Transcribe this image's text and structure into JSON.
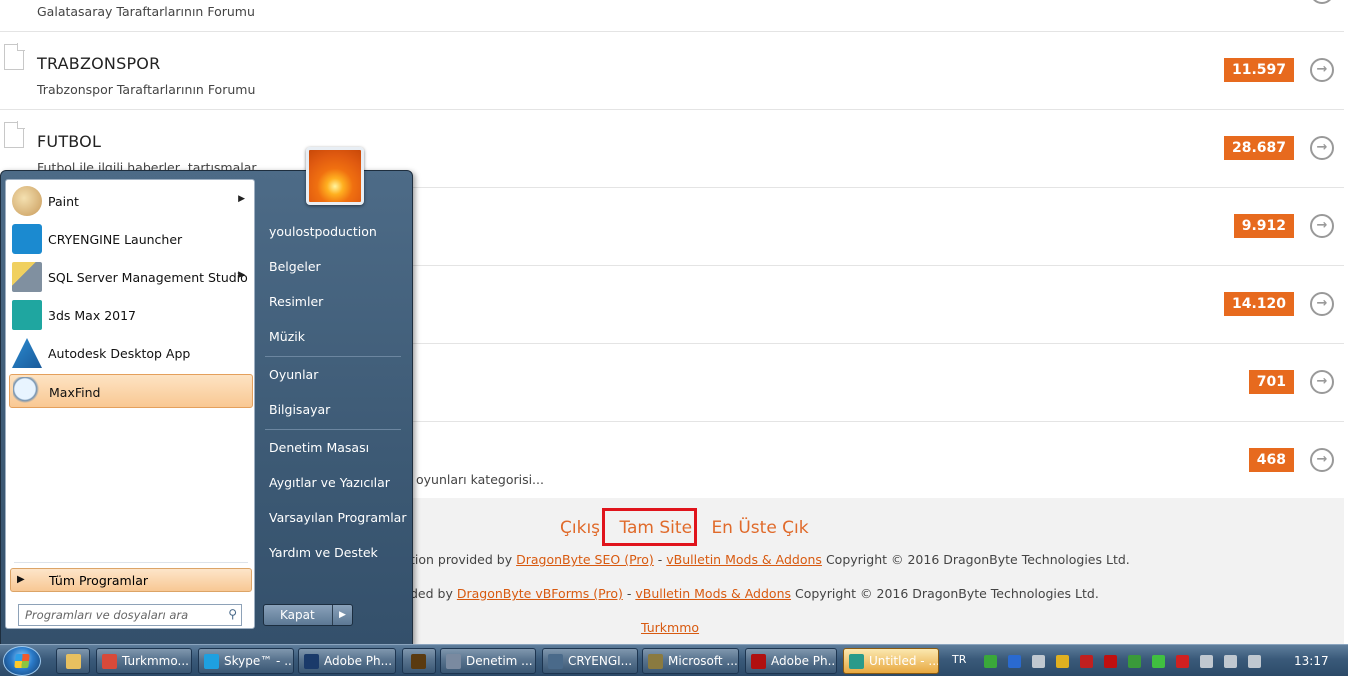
{
  "forum": {
    "rows": [
      {
        "title": "",
        "desc": "Galatasaray Taraftarlarının Forumu",
        "count": ""
      },
      {
        "title": "TRABZONSPOR",
        "desc": "Trabzonspor Taraftarlarının Forumu",
        "count": "11.597"
      },
      {
        "title": "FUTBOL",
        "desc": "Futbol ile ilgili haberler, tartışmalar",
        "count": "28.687"
      },
      {
        "title": "",
        "desc": "",
        "count": "9.912"
      },
      {
        "title": "",
        "desc": "",
        "count": "14.120"
      },
      {
        "title": "",
        "desc": "",
        "count": "701"
      },
      {
        "title": "",
        "desc": "oyunları kategorisi...",
        "count": "468"
      }
    ]
  },
  "footer": {
    "links": [
      "Çıkış",
      "Tam Site",
      "En Üste Çık"
    ],
    "line1_prefix": "tion provided by",
    "line1_link1": "DragonByte SEO (Pro)",
    "line1_sep": "-",
    "line1_link2": "vBulletin Mods & Addons",
    "line1_suffix": "Copyright © 2016 DragonByte Technologies Ltd.",
    "line2_prefix": "ded by",
    "line2_link1": "DragonByte vBForms (Pro)",
    "line2_sep": "-",
    "line2_link2": "vBulletin Mods & Addons",
    "line2_suffix": "Copyright © 2016 DragonByte Technologies Ltd.",
    "site_link": "Turkmmo"
  },
  "startmenu": {
    "programs": [
      {
        "label": "Paint",
        "icon": "paint-icon",
        "submenu": true
      },
      {
        "label": "CRYENGINE Launcher",
        "icon": "cryengine-icon",
        "submenu": false
      },
      {
        "label": "SQL Server Management Studio",
        "icon": "sql-server-icon",
        "submenu": true
      },
      {
        "label": "3ds Max 2017",
        "icon": "3dsmax-icon",
        "submenu": false
      },
      {
        "label": "Autodesk Desktop App",
        "icon": "autodesk-icon",
        "submenu": false
      },
      {
        "label": "MaxFind",
        "icon": "magnifier-icon",
        "submenu": false,
        "selected": true
      }
    ],
    "all_programs": "Tüm Programlar",
    "search_placeholder": "Programları ve dosyaları ara",
    "right_links": [
      "youlostpoduction",
      "Belgeler",
      "Resimler",
      "Müzik",
      "Oyunlar",
      "Bilgisayar",
      "Denetim Masası",
      "Aygıtlar ve Yazıcılar",
      "Varsayılan Programlar",
      "Yardım ve Destek"
    ],
    "shutdown": "Kapat"
  },
  "taskbar": {
    "buttons": [
      {
        "label": "Turkmmo...",
        "icon": "chrome-icon",
        "color": "#d84a3a"
      },
      {
        "label": "Skype™ - ...",
        "icon": "skype-icon",
        "color": "#1ea0e0"
      },
      {
        "label": "Adobe Ph...",
        "icon": "photoshop-icon",
        "color": "#1a3a6a"
      },
      {
        "label": "",
        "icon": "bridge-icon",
        "color": "#5a3a10"
      },
      {
        "label": "Denetim ...",
        "icon": "control-panel-icon",
        "color": "#7a8aa0"
      },
      {
        "label": "CRYENGI...",
        "icon": "cryengine-icon",
        "color": "#4a6a8a"
      },
      {
        "label": "Microsoft ...",
        "icon": "sql-server-icon",
        "color": "#8a7a40"
      },
      {
        "label": "Adobe Ph...",
        "icon": "acrobat-icon",
        "color": "#b01010"
      },
      {
        "label": "Untitled - ...",
        "icon": "3dsmax-icon",
        "color": "#2a9a8a",
        "active": true
      }
    ],
    "language": "TR",
    "time": "13:17"
  }
}
